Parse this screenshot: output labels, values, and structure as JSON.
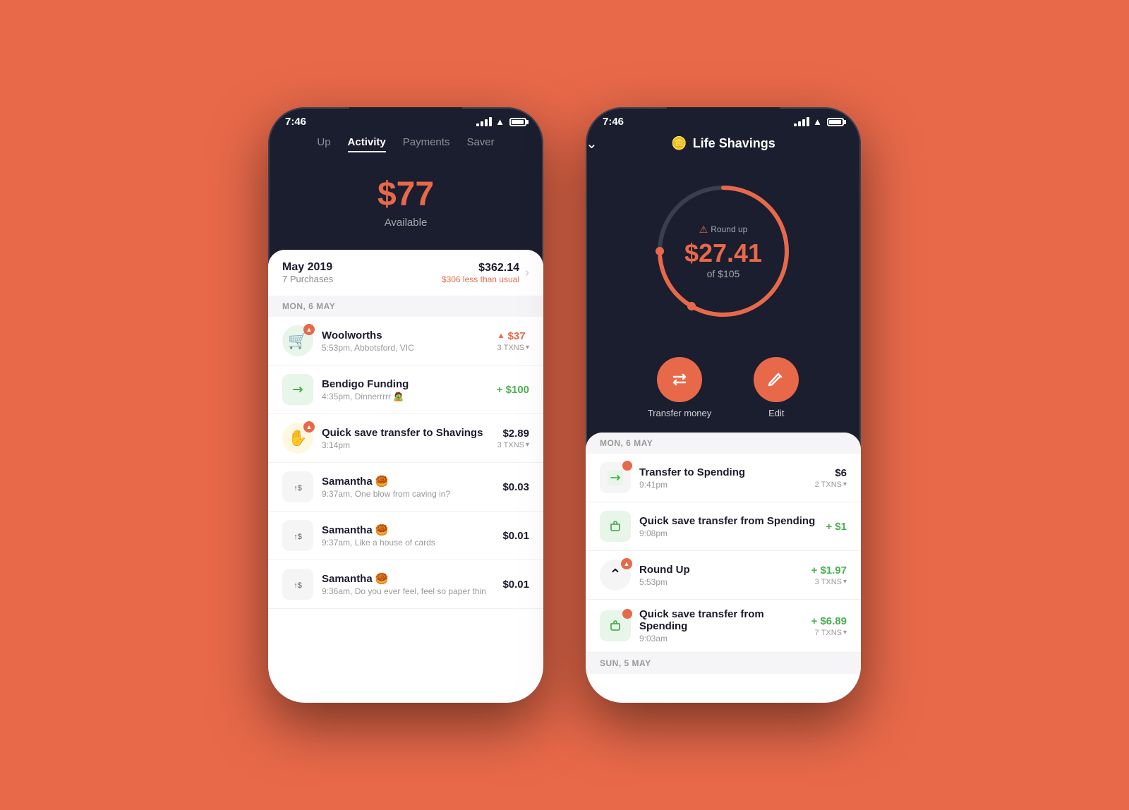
{
  "background_color": "#E8694A",
  "phone1": {
    "status": {
      "time": "7:46",
      "signal": true,
      "wifi": true,
      "battery": true
    },
    "nav": {
      "items": [
        "Up",
        "Activity",
        "Payments",
        "Saver"
      ],
      "active": "Activity"
    },
    "balance": {
      "amount": "$77",
      "label": "Available"
    },
    "month_section": {
      "month": "May 2019",
      "purchases": "7 Purchases",
      "amount": "$362.14",
      "savings": "$306 less than usual"
    },
    "day_header": "MON, 6 MAY",
    "transactions": [
      {
        "name": "Woolworths",
        "sub": "5:53pm, Abbotsford, VIC",
        "amount": "$37",
        "amount_type": "roundup",
        "txns": "3 TXNS",
        "icon": "🛒",
        "icon_bg": "#e8f5e9",
        "has_badge": true
      },
      {
        "name": "Bendigo Funding",
        "sub": "4:35pm, Dinnerrrrr 🧟",
        "amount": "+ $100",
        "amount_type": "positive",
        "txns": "",
        "icon": "💵",
        "icon_bg": "#e8f5e9",
        "has_badge": false,
        "is_transfer": true
      },
      {
        "name": "Quick save transfer to Shavings",
        "sub": "3:14pm",
        "amount": "$2.89",
        "amount_type": "normal",
        "txns": "3 TXNS",
        "icon": "✋",
        "icon_bg": "#fff8e1",
        "has_badge": true
      },
      {
        "name": "Samantha 🥮",
        "sub": "9:37am, One blow from caving in?",
        "amount": "$0.03",
        "amount_type": "normal",
        "txns": "",
        "icon": "↑$",
        "icon_bg": "#f5f5f5",
        "has_badge": false,
        "is_transfer": true
      },
      {
        "name": "Samantha 🥮",
        "sub": "9:37am, Like a house of cards",
        "amount": "$0.01",
        "amount_type": "normal",
        "txns": "",
        "icon": "↑$",
        "icon_bg": "#f5f5f5",
        "has_badge": false,
        "is_transfer": true
      },
      {
        "name": "Samantha 🥮",
        "sub": "9:36am, Do you ever feel, feel so paper thin",
        "amount": "$0.01",
        "amount_type": "normal",
        "txns": "",
        "icon": "↑$",
        "icon_bg": "#f5f5f5",
        "has_badge": false,
        "is_transfer": true
      }
    ]
  },
  "phone2": {
    "status": {
      "time": "7:46",
      "signal": true,
      "wifi": true,
      "battery": true
    },
    "header": {
      "back_label": "chevron-down",
      "title": "Life Shavings",
      "title_emoji": "🪙"
    },
    "savings": {
      "label": "Round up",
      "amount": "$27.41",
      "of_amount": "of $105",
      "progress": 0.26,
      "roundup_icon": "⚠️"
    },
    "actions": [
      {
        "label": "Transfer money",
        "icon": "transfer"
      },
      {
        "label": "Edit",
        "icon": "edit"
      }
    ],
    "day_header": "MON, 6 MAY",
    "transactions": [
      {
        "name": "Transfer to Spending",
        "sub": "9:41pm",
        "amount": "$6",
        "amount_type": "normal",
        "txns": "2 TXNS",
        "is_transfer": true,
        "has_badge": false
      },
      {
        "name": "Quick save transfer from Spending",
        "sub": "9:08pm",
        "amount": "+ $1",
        "amount_type": "positive",
        "txns": "",
        "is_transfer": true,
        "has_badge": false
      },
      {
        "name": "Round Up",
        "sub": "5:53pm",
        "amount": "+ $1.97",
        "amount_type": "positive",
        "txns": "3 TXNS",
        "is_transfer": false,
        "is_roundup": true,
        "has_badge": true
      },
      {
        "name": "Quick save transfer from Spending",
        "sub": "9:03am",
        "amount": "+ $6.89",
        "amount_type": "positive",
        "txns": "7 TXNS",
        "is_transfer": true,
        "has_badge": false
      }
    ]
  }
}
